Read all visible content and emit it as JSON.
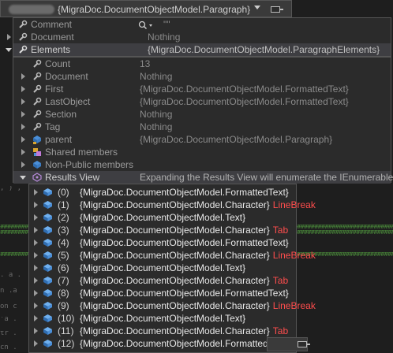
{
  "header": {
    "title": "{MigraDoc.DocumentObjectModel.Paragraph}"
  },
  "popup1": {
    "rows": [
      {
        "name": "Comment",
        "value": "\"\""
      },
      {
        "name": "Document",
        "value": "Nothing"
      },
      {
        "name": "Elements",
        "value": "{MigraDoc.DocumentObjectModel.ParagraphElements}"
      }
    ]
  },
  "popup2": {
    "rows": [
      {
        "name": "Count",
        "value": "13"
      },
      {
        "name": "Document",
        "value": "Nothing"
      },
      {
        "name": "First",
        "value": "{MigraDoc.DocumentObjectModel.FormattedText}"
      },
      {
        "name": "LastObject",
        "value": "{MigraDoc.DocumentObjectModel.FormattedText}"
      },
      {
        "name": "Section",
        "value": "Nothing"
      },
      {
        "name": "Tag",
        "value": "Nothing"
      },
      {
        "name": "parent",
        "value": "{MigraDoc.DocumentObjectModel.Paragraph}"
      },
      {
        "name": "Shared members",
        "value": ""
      },
      {
        "name": "Non-Public members",
        "value": ""
      },
      {
        "name": "Results View",
        "value": "Expanding the Results View will enumerate the IEnumerable"
      }
    ]
  },
  "items": [
    {
      "index": "(0)",
      "value": "{MigraDoc.DocumentObjectModel.FormattedText}",
      "extra": ""
    },
    {
      "index": "(1)",
      "value": "{MigraDoc.DocumentObjectModel.Character}",
      "extra": "LineBreak"
    },
    {
      "index": "(2)",
      "value": "{MigraDoc.DocumentObjectModel.Text}",
      "extra": ""
    },
    {
      "index": "(3)",
      "value": "{MigraDoc.DocumentObjectModel.Character}",
      "extra": "Tab"
    },
    {
      "index": "(4)",
      "value": "{MigraDoc.DocumentObjectModel.FormattedText}",
      "extra": ""
    },
    {
      "index": "(5)",
      "value": "{MigraDoc.DocumentObjectModel.Character}",
      "extra": "LineBreak"
    },
    {
      "index": "(6)",
      "value": "{MigraDoc.DocumentObjectModel.Text}",
      "extra": ""
    },
    {
      "index": "(7)",
      "value": "{MigraDoc.DocumentObjectModel.Character}",
      "extra": "Tab"
    },
    {
      "index": "(8)",
      "value": "{MigraDoc.DocumentObjectModel.FormattedText}",
      "extra": ""
    },
    {
      "index": "(9)",
      "value": "{MigraDoc.DocumentObjectModel.Character}",
      "extra": "LineBreak"
    },
    {
      "index": "(10)",
      "value": "{MigraDoc.DocumentObjectModel.Text}",
      "extra": ""
    },
    {
      "index": "(11)",
      "value": "{MigraDoc.DocumentObjectModel.Character}",
      "extra": "Tab"
    },
    {
      "index": "(12)",
      "value": "{MigraDoc.DocumentObjectModel.FormattedText}",
      "extra": ""
    }
  ],
  "colors": {
    "accent_red": "#ff4d4d",
    "background": "#1e1e1e",
    "popup": "#2b2b2b"
  }
}
